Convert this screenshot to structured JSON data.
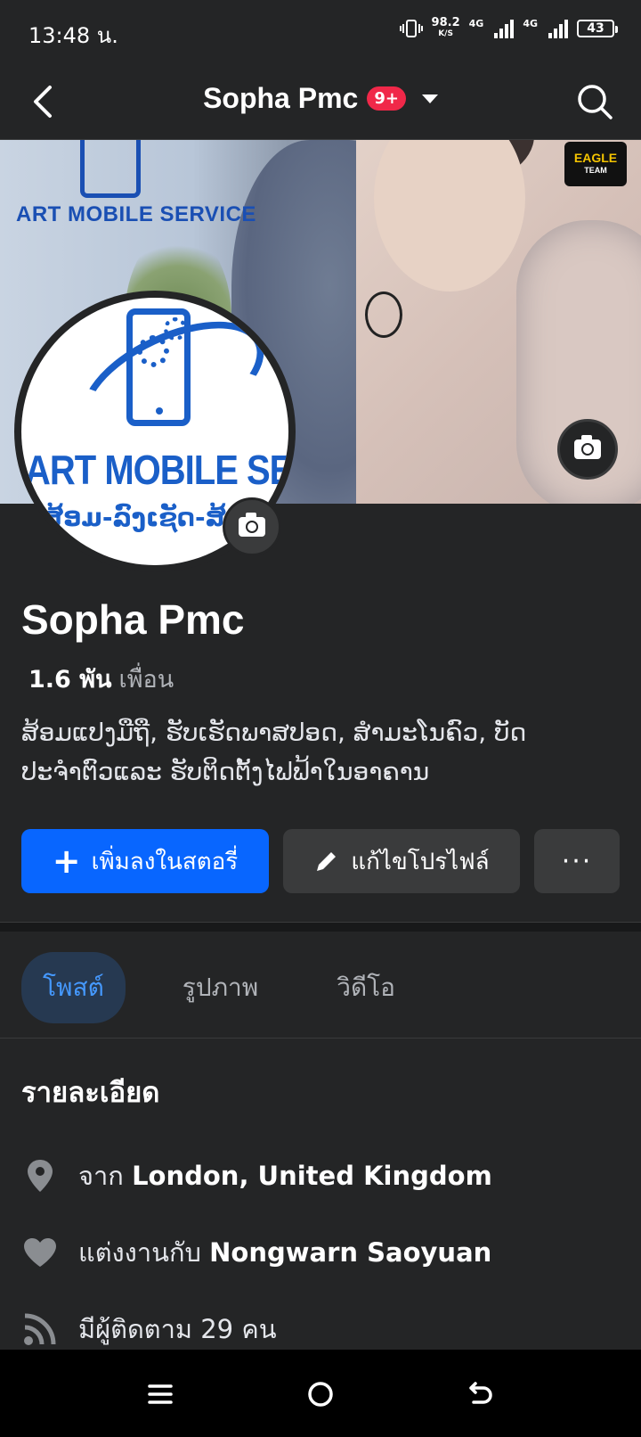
{
  "status_bar": {
    "time": "13:48 น.",
    "net_speed_value": "98.2",
    "net_speed_unit": "K/S",
    "sim1_label": "4G",
    "sim2_label": "4G",
    "battery": "43"
  },
  "header": {
    "title": "Sopha Pmc",
    "badge": "9+"
  },
  "cover": {
    "brand_text": "ART MOBILE SERVICE",
    "eagle_line1": "EAGLE",
    "eagle_line2": "TEAM"
  },
  "avatar": {
    "brand_text": "ART MOBILE SERVICE",
    "sub_text": "ສ້ອມ-ລົງເຊັດ-ສ້ອມ"
  },
  "profile": {
    "name": "Sopha Pmc",
    "friends_count": "1.6 พัน",
    "friends_label": "เพื่อน",
    "bio_line1": "ສ້ອມແປງມືຖື, ຮັບເຮັດພາສປອດ, ສຳມະໂນຄົວ, ບັດ",
    "bio_line2": "ປະຈຳຕົວແລະ ຮັບຕິດຕັ້ງໄຟຟ້າໃນອາຄານ"
  },
  "actions": {
    "add_story": "เพิ่มลงในสตอรี่",
    "edit_profile": "แก้ไขโปรไฟล์",
    "more": "···"
  },
  "tabs": [
    "โพสต์",
    "รูปภาพ",
    "วิดีโอ"
  ],
  "details": {
    "title": "รายละเอียด",
    "location_prefix": "จาก",
    "location": "London, United Kingdom",
    "relationship_prefix": "แต่งงานกับ",
    "relationship": "Nongwarn Saoyuan",
    "followers_prefix": "มีผู้ติดตาม",
    "followers": "29 คน"
  },
  "colors": {
    "accent": "#0866ff",
    "badge": "#f02849",
    "background": "#242526"
  }
}
